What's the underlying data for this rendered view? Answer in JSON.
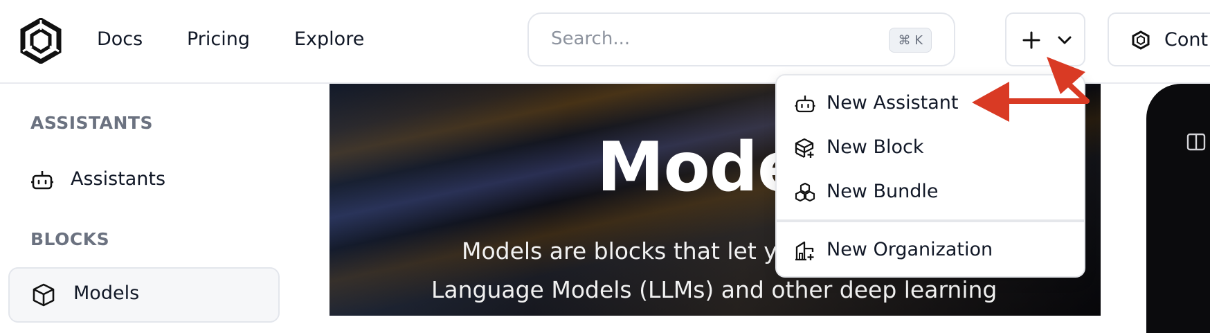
{
  "header": {
    "nav": [
      "Docs",
      "Pricing",
      "Explore"
    ],
    "search": {
      "placeholder": "Search...",
      "shortcut": "⌘ K"
    },
    "create_button": {
      "icon": "plus-icon",
      "chevron": "chevron-down-icon"
    },
    "contact_button": {
      "label": "Cont"
    }
  },
  "sidebar": {
    "sections": [
      {
        "title": "ASSISTANTS",
        "items": [
          {
            "label": "Assistants",
            "icon": "robot-icon"
          }
        ]
      },
      {
        "title": "BLOCKS",
        "items": [
          {
            "label": "Models",
            "icon": "cube-icon",
            "selected": true
          }
        ]
      }
    ]
  },
  "hero": {
    "title": "Mode",
    "subtitle_line1": "Models are blocks that let y",
    "subtitle_line2": "Language Models (LLMs) and other deep learning"
  },
  "dropdown": {
    "items": [
      {
        "label": "New Assistant",
        "icon": "robot-icon"
      },
      {
        "label": "New Block",
        "icon": "package-plus-icon"
      },
      {
        "label": "New Bundle",
        "icon": "boxes-icon"
      },
      {
        "label": "New Organization",
        "icon": "building-plus-icon"
      }
    ]
  },
  "colors": {
    "annotation_arrow": "#d93a24",
    "muted_text": "#6b7280",
    "border": "#e3e6ec"
  }
}
